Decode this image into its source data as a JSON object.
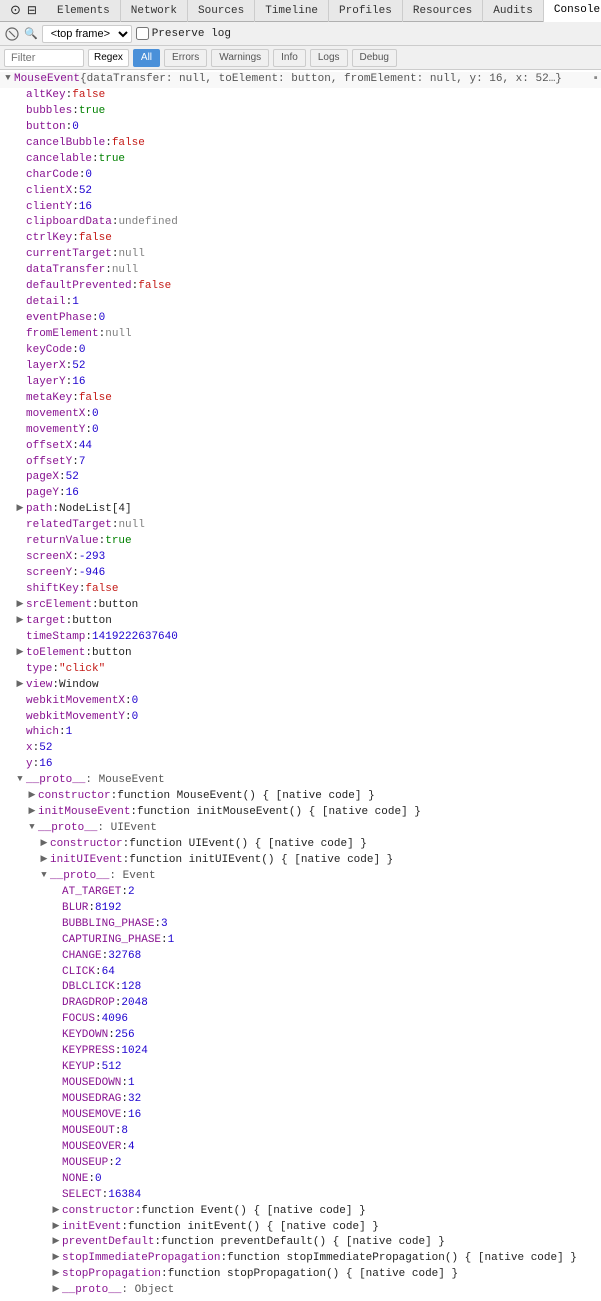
{
  "tabs": [
    {
      "label": "Elements",
      "active": false
    },
    {
      "label": "Network",
      "active": false
    },
    {
      "label": "Sources",
      "active": false
    },
    {
      "label": "Timeline",
      "active": false
    },
    {
      "label": "Profiles",
      "active": false
    },
    {
      "label": "Resources",
      "active": false
    },
    {
      "label": "Audits",
      "active": false
    },
    {
      "label": "Console",
      "active": true
    }
  ],
  "toolbar": {
    "frame_select_label": "<top frame>",
    "preserve_label": "Preserve log"
  },
  "filter_bar": {
    "filter_placeholder": "Filter",
    "regex_label": "Regex",
    "all_label": "All",
    "errors_label": "Errors",
    "warnings_label": "Warnings",
    "info_label": "Info",
    "logs_label": "Logs",
    "debug_label": "Debug"
  },
  "console": {
    "object_header": "▼ MouseEvent {dataTransfer: null, toElement: button, fromElement: null, y: 16, x: 52…}",
    "properties": [
      {
        "indent": 1,
        "expand": "empty",
        "key": "altKey",
        "sep": ": ",
        "val": "false",
        "type": "bool_false"
      },
      {
        "indent": 1,
        "expand": "empty",
        "key": "bubbles",
        "sep": ": ",
        "val": "true",
        "type": "bool_true"
      },
      {
        "indent": 1,
        "expand": "empty",
        "key": "button",
        "sep": ": ",
        "val": "0",
        "type": "num"
      },
      {
        "indent": 1,
        "expand": "empty",
        "key": "cancelBubble",
        "sep": ": ",
        "val": "false",
        "type": "bool_false"
      },
      {
        "indent": 1,
        "expand": "empty",
        "key": "cancelable",
        "sep": ": ",
        "val": "true",
        "type": "bool_true"
      },
      {
        "indent": 1,
        "expand": "empty",
        "key": "charCode",
        "sep": ": ",
        "val": "0",
        "type": "num"
      },
      {
        "indent": 1,
        "expand": "empty",
        "key": "clientX",
        "sep": ": ",
        "val": "52",
        "type": "num"
      },
      {
        "indent": 1,
        "expand": "empty",
        "key": "clientY",
        "sep": ": ",
        "val": "16",
        "type": "num"
      },
      {
        "indent": 1,
        "expand": "empty",
        "key": "clipboardData",
        "sep": ": ",
        "val": "undefined",
        "type": "undef"
      },
      {
        "indent": 1,
        "expand": "empty",
        "key": "ctrlKey",
        "sep": ": ",
        "val": "false",
        "type": "bool_false"
      },
      {
        "indent": 1,
        "expand": "empty",
        "key": "currentTarget",
        "sep": ": ",
        "val": "null",
        "type": "null"
      },
      {
        "indent": 1,
        "expand": "empty",
        "key": "dataTransfer",
        "sep": ": ",
        "val": "null",
        "type": "null"
      },
      {
        "indent": 1,
        "expand": "empty",
        "key": "defaultPrevented",
        "sep": ": ",
        "val": "false",
        "type": "bool_false"
      },
      {
        "indent": 1,
        "expand": "empty",
        "key": "detail",
        "sep": ": ",
        "val": "1",
        "type": "num"
      },
      {
        "indent": 1,
        "expand": "empty",
        "key": "eventPhase",
        "sep": ": ",
        "val": "0",
        "type": "num"
      },
      {
        "indent": 1,
        "expand": "empty",
        "key": "fromElement",
        "sep": ": ",
        "val": "null",
        "type": "null"
      },
      {
        "indent": 1,
        "expand": "empty",
        "key": "keyCode",
        "sep": ": ",
        "val": "0",
        "type": "num"
      },
      {
        "indent": 1,
        "expand": "empty",
        "key": "layerX",
        "sep": ": ",
        "val": "52",
        "type": "num"
      },
      {
        "indent": 1,
        "expand": "empty",
        "key": "layerY",
        "sep": ": ",
        "val": "16",
        "type": "num"
      },
      {
        "indent": 1,
        "expand": "empty",
        "key": "metaKey",
        "sep": ": ",
        "val": "false",
        "type": "bool_false"
      },
      {
        "indent": 1,
        "expand": "empty",
        "key": "movementX",
        "sep": ": ",
        "val": "0",
        "type": "num"
      },
      {
        "indent": 1,
        "expand": "empty",
        "key": "movementY",
        "sep": ": ",
        "val": "0",
        "type": "num"
      },
      {
        "indent": 1,
        "expand": "empty",
        "key": "offsetX",
        "sep": ": ",
        "val": "44",
        "type": "num"
      },
      {
        "indent": 1,
        "expand": "empty",
        "key": "offsetY",
        "sep": ": ",
        "val": "7",
        "type": "num"
      },
      {
        "indent": 1,
        "expand": "empty",
        "key": "pageX",
        "sep": ": ",
        "val": "52",
        "type": "num"
      },
      {
        "indent": 1,
        "expand": "empty",
        "key": "pageY",
        "sep": ": ",
        "val": "16",
        "type": "num"
      },
      {
        "indent": 1,
        "expand": "collapsed",
        "key": "path",
        "sep": ": ",
        "val": "NodeList[4]",
        "type": "obj"
      },
      {
        "indent": 1,
        "expand": "empty",
        "key": "relatedTarget",
        "sep": ": ",
        "val": "null",
        "type": "null"
      },
      {
        "indent": 1,
        "expand": "empty",
        "key": "returnValue",
        "sep": ": ",
        "val": "true",
        "type": "bool_true"
      },
      {
        "indent": 1,
        "expand": "empty",
        "key": "screenX",
        "sep": ": ",
        "val": "-293",
        "type": "num"
      },
      {
        "indent": 1,
        "expand": "empty",
        "key": "screenY",
        "sep": ": ",
        "val": "-946",
        "type": "num"
      },
      {
        "indent": 1,
        "expand": "empty",
        "key": "shiftKey",
        "sep": ": ",
        "val": "false",
        "type": "bool_false"
      },
      {
        "indent": 1,
        "expand": "collapsed",
        "key": "srcElement",
        "sep": ": ",
        "val": "button",
        "type": "obj"
      },
      {
        "indent": 1,
        "expand": "collapsed",
        "key": "target",
        "sep": ": ",
        "val": "button",
        "type": "obj"
      },
      {
        "indent": 1,
        "expand": "empty",
        "key": "timeStamp",
        "sep": ": ",
        "val": "1419222637640",
        "type": "num"
      },
      {
        "indent": 1,
        "expand": "collapsed",
        "key": "toElement",
        "sep": ": ",
        "val": "button",
        "type": "obj"
      },
      {
        "indent": 1,
        "expand": "empty",
        "key": "type",
        "sep": ": ",
        "val": "\"click\"",
        "type": "str"
      },
      {
        "indent": 1,
        "expand": "collapsed",
        "key": "view",
        "sep": ": ",
        "val": "Window",
        "type": "obj"
      },
      {
        "indent": 1,
        "expand": "empty",
        "key": "webkitMovementX",
        "sep": ": ",
        "val": "0",
        "type": "num"
      },
      {
        "indent": 1,
        "expand": "empty",
        "key": "webkitMovementY",
        "sep": ": ",
        "val": "0",
        "type": "num"
      },
      {
        "indent": 1,
        "expand": "empty",
        "key": "which",
        "sep": ": ",
        "val": "1",
        "type": "num"
      },
      {
        "indent": 1,
        "expand": "empty",
        "key": "x",
        "sep": ": ",
        "val": "52",
        "type": "num"
      },
      {
        "indent": 1,
        "expand": "empty",
        "key": "y",
        "sep": ": ",
        "val": "16",
        "type": "num"
      }
    ],
    "proto_mouseevent": {
      "label": "▼ __proto__",
      "sublabel": ": MouseEvent",
      "indent": 1,
      "items": [
        {
          "indent": 2,
          "expand": "collapsed",
          "key": "constructor",
          "sep": ": ",
          "val": "function MouseEvent() { [native code] }"
        },
        {
          "indent": 2,
          "expand": "collapsed",
          "key": "initMouseEvent",
          "sep": ": ",
          "val": "function initMouseEvent() { [native code] }"
        }
      ]
    },
    "proto_uievent": {
      "label": "▼ __proto__",
      "sublabel": ": UIEvent",
      "indent": 2,
      "items": [
        {
          "indent": 3,
          "expand": "collapsed",
          "key": "constructor",
          "sep": ": ",
          "val": "function UIEvent() { [native code] }"
        },
        {
          "indent": 3,
          "expand": "collapsed",
          "key": "initUIEvent",
          "sep": ": ",
          "val": "function initUIEvent() { [native code] }"
        }
      ]
    },
    "proto_event": {
      "label": "▼ __proto__",
      "sublabel": ": Event",
      "indent": 3,
      "constants": [
        {
          "indent": 4,
          "key": "AT_TARGET",
          "val": "2"
        },
        {
          "indent": 4,
          "key": "BLUR",
          "val": "8192"
        },
        {
          "indent": 4,
          "key": "BUBBLING_PHASE",
          "val": "3"
        },
        {
          "indent": 4,
          "key": "CAPTURING_PHASE",
          "val": "1"
        },
        {
          "indent": 4,
          "key": "CHANGE",
          "val": "32768"
        },
        {
          "indent": 4,
          "key": "CLICK",
          "val": "64"
        },
        {
          "indent": 4,
          "key": "DBLCLICK",
          "val": "128"
        },
        {
          "indent": 4,
          "key": "DRAGDROP",
          "val": "2048"
        },
        {
          "indent": 4,
          "key": "FOCUS",
          "val": "4096"
        },
        {
          "indent": 4,
          "key": "KEYDOWN",
          "val": "256"
        },
        {
          "indent": 4,
          "key": "KEYPRESS",
          "val": "1024"
        },
        {
          "indent": 4,
          "key": "KEYUP",
          "val": "512"
        },
        {
          "indent": 4,
          "key": "MOUSEDOWN",
          "val": "1"
        },
        {
          "indent": 4,
          "key": "MOUSEDRAG",
          "val": "32"
        },
        {
          "indent": 4,
          "key": "MOUSEMOVE",
          "val": "16"
        },
        {
          "indent": 4,
          "key": "MOUSEOUT",
          "val": "8"
        },
        {
          "indent": 4,
          "key": "MOUSEOVER",
          "val": "4"
        },
        {
          "indent": 4,
          "key": "MOUSEUP",
          "val": "2"
        },
        {
          "indent": 4,
          "key": "NONE",
          "val": "0"
        },
        {
          "indent": 4,
          "key": "SELECT",
          "val": "16384"
        }
      ],
      "methods": [
        {
          "indent": 4,
          "expand": "collapsed",
          "key": "constructor",
          "val": "function Event() { [native code] }"
        },
        {
          "indent": 4,
          "expand": "collapsed",
          "key": "initEvent",
          "val": "function initEvent() { [native code] }"
        },
        {
          "indent": 4,
          "expand": "collapsed",
          "key": "preventDefault",
          "val": "function preventDefault() { [native code] }"
        },
        {
          "indent": 4,
          "expand": "collapsed",
          "key": "stopImmediatePropagation",
          "val": "function stopImmediatePropagation() { [native code] }"
        },
        {
          "indent": 4,
          "expand": "collapsed",
          "key": "stopPropagation",
          "val": "function stopPropagation() { [native code] }"
        }
      ]
    },
    "proto_object_label": "▶ __proto__",
    "proto_object_sublabel": ": Object"
  }
}
